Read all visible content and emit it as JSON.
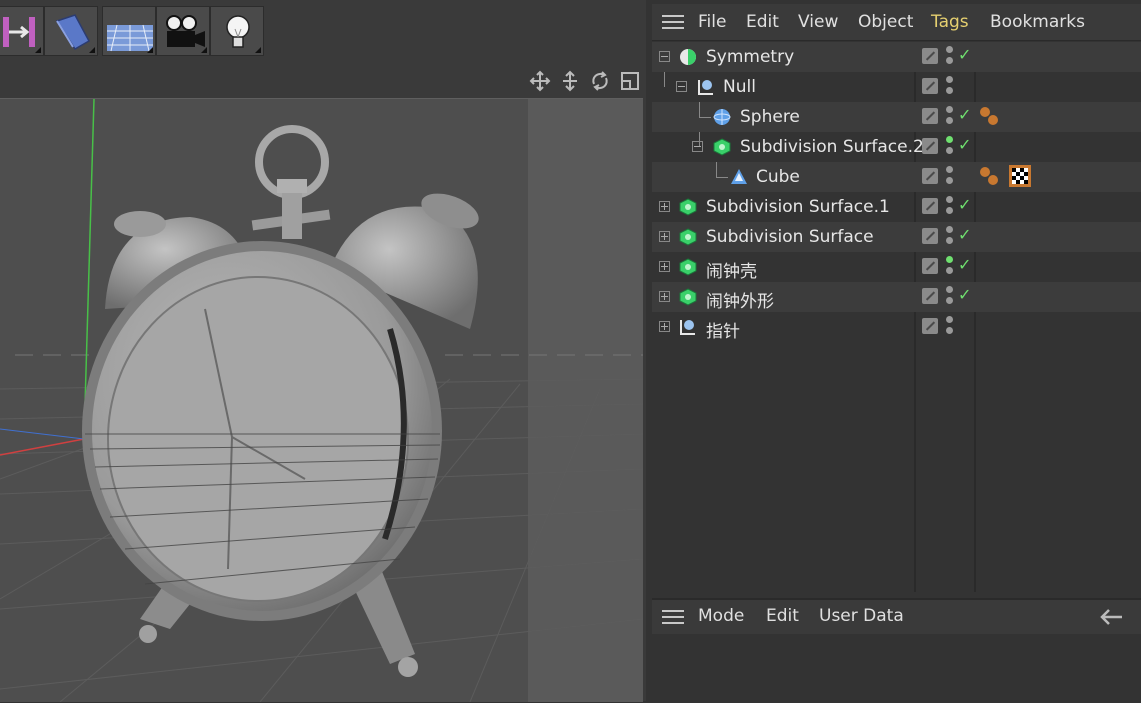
{
  "object_manager": {
    "menu": [
      "File",
      "Edit",
      "View",
      "Object",
      "Tags",
      "Bookmarks"
    ],
    "accent_color": "#e6d070",
    "rows": [
      {
        "name": "Symmetry",
        "icon": "symmetry-icon",
        "checked": true,
        "tags": []
      },
      {
        "name": "Null",
        "icon": "null-icon",
        "checked": false,
        "tags": []
      },
      {
        "name": "Sphere",
        "icon": "sphere-icon",
        "checked": true,
        "tags": [
          "phong-tag-icon"
        ]
      },
      {
        "name": "Subdivision Surface.2",
        "icon": "subdivision-surface-icon",
        "checked": true,
        "tags": []
      },
      {
        "name": "Cube",
        "icon": "cube-icon",
        "checked": false,
        "tags": [
          "phong-tag-icon",
          "texture-tag-icon"
        ]
      },
      {
        "name": "Subdivision Surface.1",
        "icon": "subdivision-surface-icon",
        "checked": true,
        "tags": []
      },
      {
        "name": "Subdivision Surface",
        "icon": "subdivision-surface-icon",
        "checked": true,
        "tags": []
      },
      {
        "name": "闹钟壳",
        "icon": "subdivision-surface-icon",
        "checked": true,
        "tags": []
      },
      {
        "name": "闹钟外形",
        "icon": "subdivision-surface-icon",
        "checked": true,
        "tags": []
      },
      {
        "name": "指针",
        "icon": "null-icon",
        "checked": false,
        "tags": []
      }
    ]
  },
  "attribute_manager": {
    "menu": [
      "Mode",
      "Edit",
      "User Data"
    ],
    "back_icon": "arrow-left-icon"
  },
  "toolbar": {
    "icons": [
      "deformer-icon",
      "extrude-icon",
      "floor-icon",
      "camera-icon",
      "light-icon"
    ]
  },
  "viewport": {
    "nav_icons": [
      "move-view-icon",
      "zoom-view-icon",
      "rotate-view-icon",
      "maximize-view-icon"
    ],
    "scene": "alarm-clock-model"
  }
}
